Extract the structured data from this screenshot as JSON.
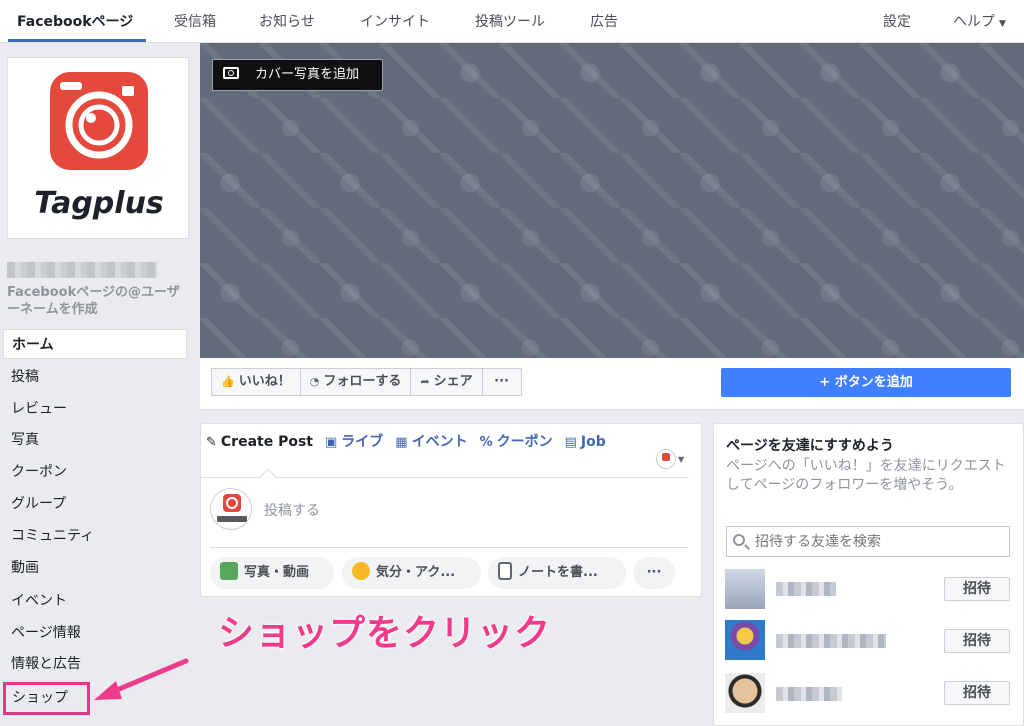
{
  "topnav": {
    "tabs": [
      "Facebookページ",
      "受信箱",
      "お知らせ",
      "インサイト",
      "投稿ツール",
      "広告"
    ],
    "settings": "設定",
    "help": "ヘルプ"
  },
  "page": {
    "logo_text": "Tagplus",
    "username_link": "Facebookページの@ユーザーネームを作成"
  },
  "sidebar": {
    "items": [
      "ホーム",
      "投稿",
      "レビュー",
      "写真",
      "クーポン",
      "グループ",
      "コミュニティ",
      "動画",
      "イベント",
      "ページ情報",
      "情報と広告",
      "ショップ"
    ]
  },
  "cover": {
    "add_cover_label": "カバー写真を追加"
  },
  "actions": {
    "like": "いいね！",
    "follow": "フォローする",
    "share": "シェア",
    "more": "···",
    "add_button": "+ ボタンを追加"
  },
  "composer": {
    "tabs": [
      "Create Post",
      "ライブ",
      "イベント",
      "クーポン",
      "Job"
    ],
    "placeholder": "投稿する",
    "photo_video": "写真・動画",
    "feeling": "気分・アク...",
    "note": "ノートを書...",
    "more": "···"
  },
  "annotation": "ショップをクリック",
  "invite": {
    "title": "ページを友達にすすめよう",
    "description": "ページへの「いいね！」を友達にリクエストしてページのフォロワーを増やそう。",
    "search_placeholder": "招待する友達を検索",
    "invite_label": "招待"
  },
  "colors": {
    "fb_blue": "#4267b2",
    "add_button_blue": "#4080ff",
    "highlight_pink": "#e8358a",
    "logo_red": "#e5483d"
  }
}
